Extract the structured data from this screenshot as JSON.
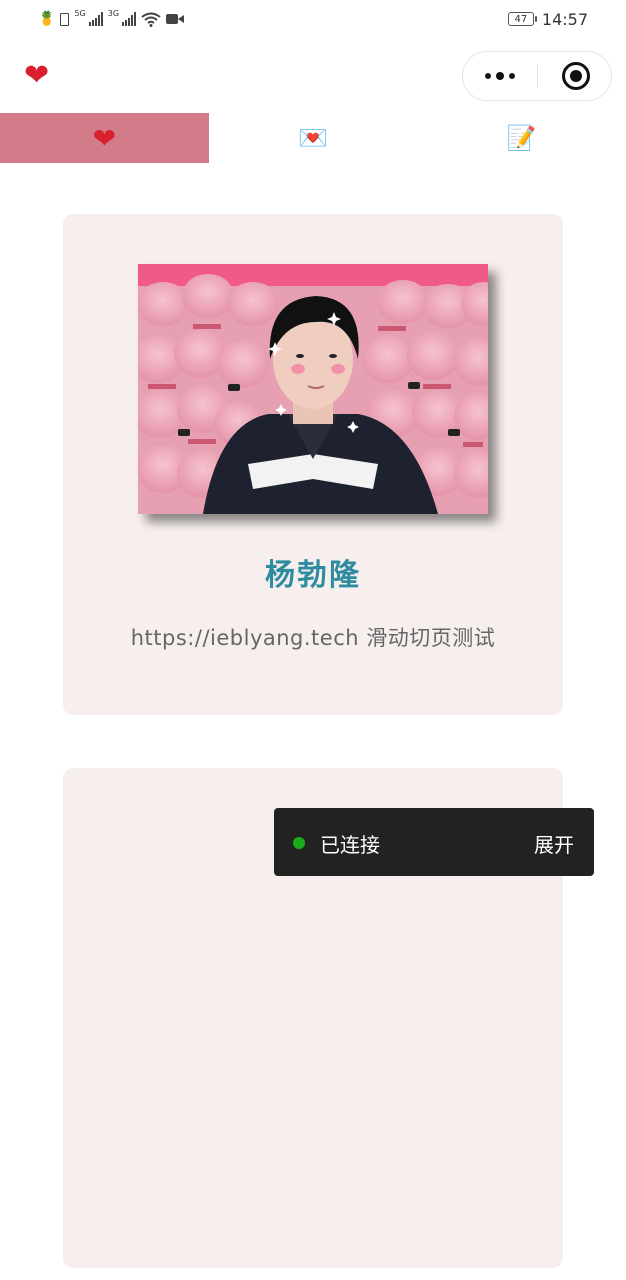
{
  "status_bar": {
    "network_1": "5G",
    "network_2": "3G",
    "battery": "47",
    "time": "14:57"
  },
  "nav": {
    "icon": "heart-icon",
    "more_icon": "more-dots-icon",
    "close_icon": "target-close-icon"
  },
  "tabs": [
    {
      "icon": "heart-icon",
      "glyph": "❤",
      "active": true
    },
    {
      "icon": "love-letter-icon",
      "glyph": "💌",
      "active": false
    },
    {
      "icon": "memo-icon",
      "glyph": "📝",
      "active": false
    }
  ],
  "profile": {
    "name": "杨勃隆",
    "subtitle": "https://ieblyang.tech 滑动切页测试"
  },
  "toast": {
    "status": "已连接",
    "expand": "展开"
  },
  "colors": {
    "accent_tab": "#d27c8a",
    "name": "#2f8ca0",
    "card_bg": "#f7efee",
    "connected_dot": "#1aad19"
  }
}
